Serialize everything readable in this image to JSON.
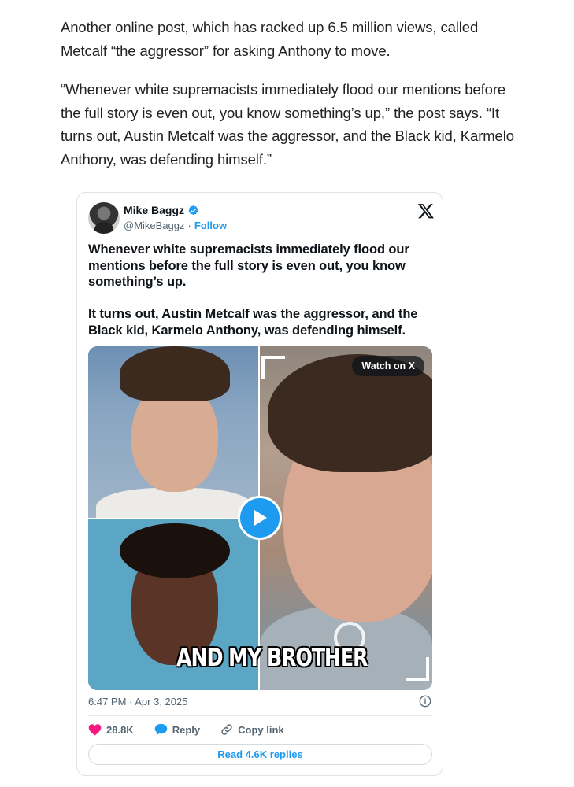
{
  "article": {
    "paragraphs": [
      "Another online post, which has racked up 6.5 million views, called Metcalf “the aggressor” for asking Anthony to move.",
      "“Whenever white supremacists immediately flood our mentions before the full story is even out, you know something’s up,” the post says. “It turns out, Austin Metcalf was the aggressor, and the Black kid, Karmelo Anthony, was defending himself.”"
    ]
  },
  "tweet": {
    "author_name": "Mike Baggz",
    "handle": "@MikeBaggz",
    "separator": "·",
    "follow_label": "Follow",
    "text_1": "Whenever white supremacists immediately flood our mentions before the full story is even out, you know something’s up.",
    "text_2": "It turns out, Austin Metcalf was the aggressor, and the Black kid, Karmelo Anthony, was defending himself.",
    "media": {
      "watch_label": "Watch on X",
      "caption": "AND MY BROTHER"
    },
    "timestamp": "6:47 PM · Apr 3, 2025",
    "likes": "28.8K",
    "reply_label": "Reply",
    "copy_link_label": "Copy link",
    "read_replies_label": "Read 4.6K replies"
  },
  "colors": {
    "accent": "#1d9bf0",
    "like": "#f91880",
    "muted_text": "#536471"
  },
  "icons": [
    "verified-badge-icon",
    "x-logo-icon",
    "play-icon",
    "info-icon",
    "heart-icon",
    "reply-bubble-icon",
    "link-icon"
  ]
}
